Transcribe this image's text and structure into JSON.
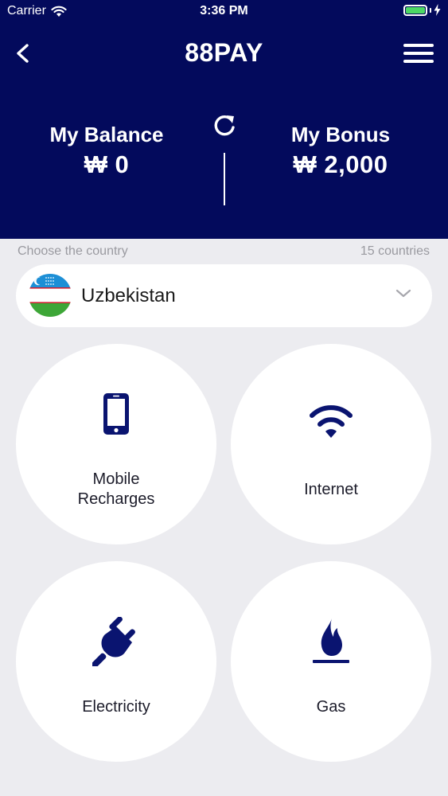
{
  "status_bar": {
    "carrier": "Carrier",
    "time": "3:36 PM",
    "wifi_icon": "wifi-icon",
    "battery_icon": "battery-icon"
  },
  "nav": {
    "title": "88PAY",
    "back_icon": "back-chevron-icon",
    "menu_icon": "hamburger-menu-icon"
  },
  "balance": {
    "balance_label": "My Balance",
    "balance_value": "₩ 0",
    "bonus_label": "My Bonus",
    "bonus_value": "₩ 2,000",
    "refresh_icon": "refresh-icon"
  },
  "country": {
    "choose_label": "Choose the country",
    "count_label": "15 countries",
    "selected": "Uzbekistan",
    "flag_icon": "uzbekistan-flag-icon"
  },
  "services": [
    {
      "label": "Mobile\nRecharges",
      "icon": "mobile-phone-icon"
    },
    {
      "label": "Internet",
      "icon": "wifi-icon"
    },
    {
      "label": "Electricity",
      "icon": "plug-icon"
    },
    {
      "label": "Gas",
      "icon": "flame-icon"
    }
  ],
  "colors": {
    "header_bg": "#030a5c",
    "accent": "#0a1470",
    "page_bg": "#ececf0",
    "battery": "#4cd964"
  }
}
